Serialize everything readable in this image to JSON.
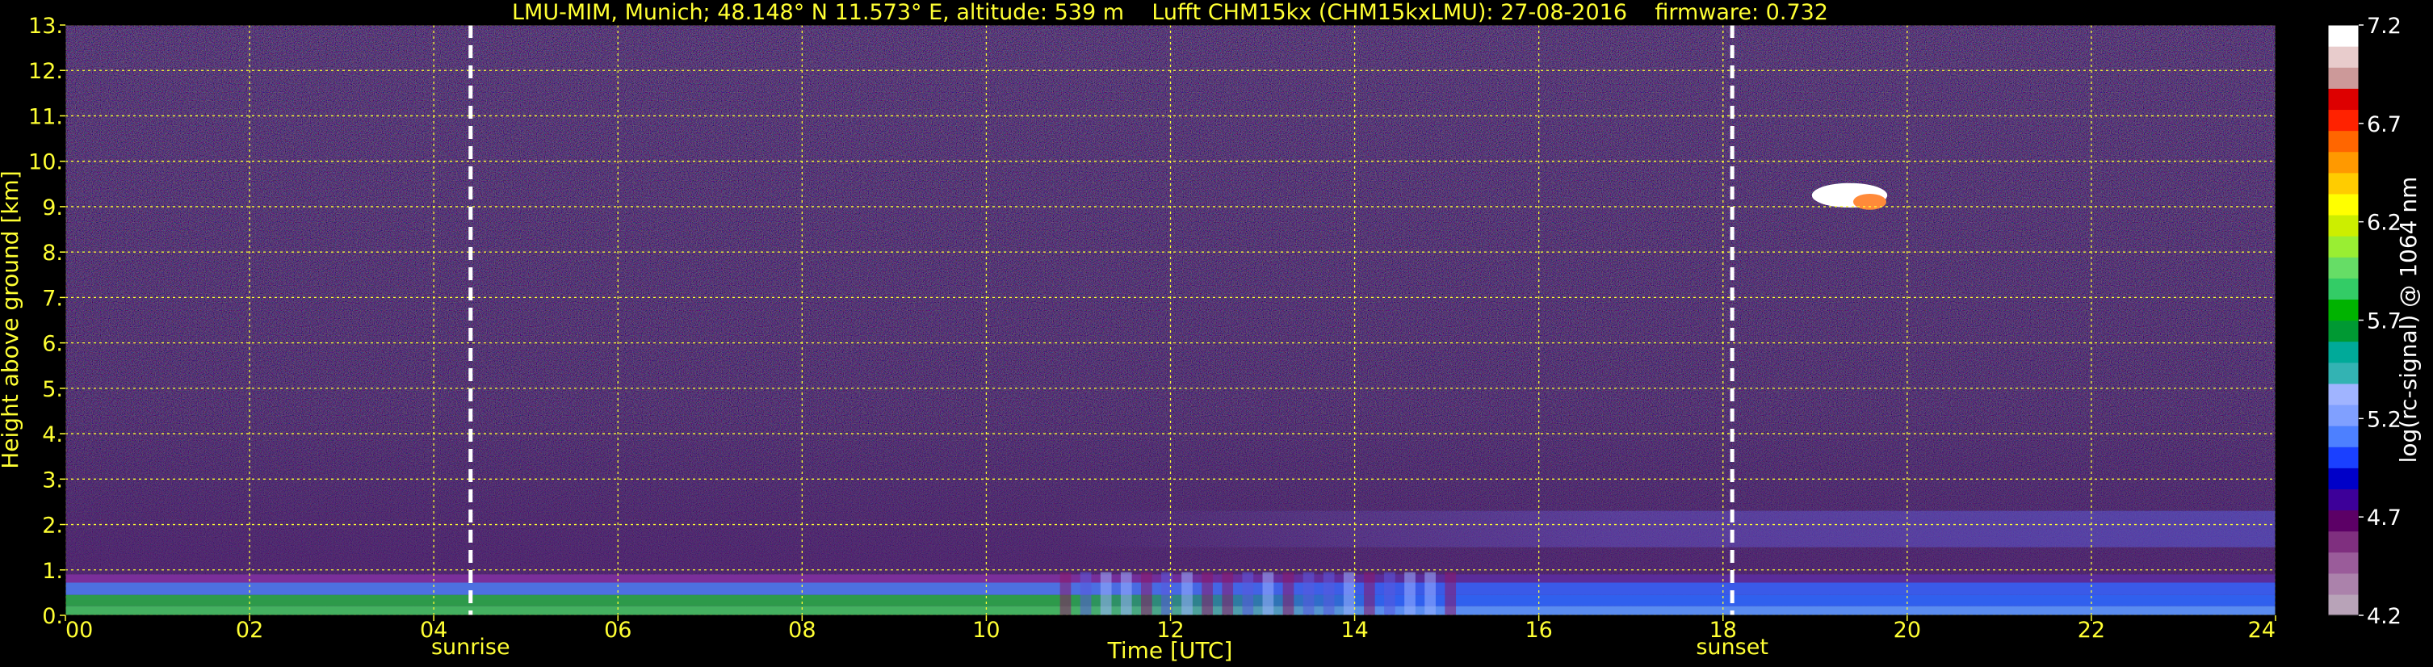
{
  "chart_data": {
    "type": "heatmap",
    "title": "LMU-MIM, Munich; 48.148° N 11.573° E, altitude: 539 m    Lufft CHM15kx (CHM15kxLMU): 27-08-2016    firmware: 0.732",
    "xlabel": "Time [UTC]",
    "ylabel": "Height above ground [km]",
    "xlim": [
      0,
      24
    ],
    "ylim": [
      0,
      13
    ],
    "x_ticks": [
      0,
      2,
      4,
      6,
      8,
      10,
      12,
      14,
      16,
      18,
      20,
      22,
      24
    ],
    "x_tick_labels": [
      "00",
      "02",
      "04",
      "06",
      "08",
      "10",
      "12",
      "14",
      "16",
      "18",
      "20",
      "22",
      "24"
    ],
    "y_ticks": [
      0,
      1,
      2,
      3,
      4,
      5,
      6,
      7,
      8,
      9,
      10,
      11,
      12,
      13
    ],
    "y_tick_labels": [
      "0.",
      "1.",
      "2.",
      "3.",
      "4.",
      "5.",
      "6.",
      "7.",
      "8.",
      "9.",
      "10.",
      "11.",
      "12.",
      "13."
    ],
    "grid": true,
    "colorbar": {
      "label": "log(rc-signal) @ 1064 nm",
      "range": [
        4.2,
        7.2
      ],
      "tick_values": [
        4.2,
        4.7,
        5.2,
        5.7,
        6.2,
        6.7,
        7.2
      ],
      "tick_labels": [
        "4.2",
        "4.7",
        "5.2",
        "5.7",
        "6.2",
        "6.7",
        "7.2"
      ],
      "colors": [
        "#b8a3b8",
        "#ab82ab",
        "#9a5c9a",
        "#7f2f7f",
        "#5c0066",
        "#3d0099",
        "#0000c8",
        "#1a40ff",
        "#4d80ff",
        "#80a0ff",
        "#a0b4ff",
        "#33b3b3",
        "#00aa99",
        "#009933",
        "#00b300",
        "#33cc66",
        "#66dd66",
        "#99ee33",
        "#ccee00",
        "#ffff00",
        "#ffcc00",
        "#ff9900",
        "#ff6600",
        "#ff2200",
        "#dd0000",
        "#cc9999",
        "#e8cccc",
        "#ffffff"
      ]
    },
    "annotations": [
      {
        "x": 4.4,
        "label": "sunrise"
      },
      {
        "x": 18.1,
        "label": "sunset"
      }
    ],
    "features": [
      {
        "name": "aerosol boundary layer",
        "x_range": [
          0,
          24
        ],
        "top_km": 0.9
      },
      {
        "name": "cirrus cloud",
        "x_range": [
          19.1,
          20.0
        ],
        "height_km": [
          8.9,
          9.6
        ]
      }
    ]
  }
}
